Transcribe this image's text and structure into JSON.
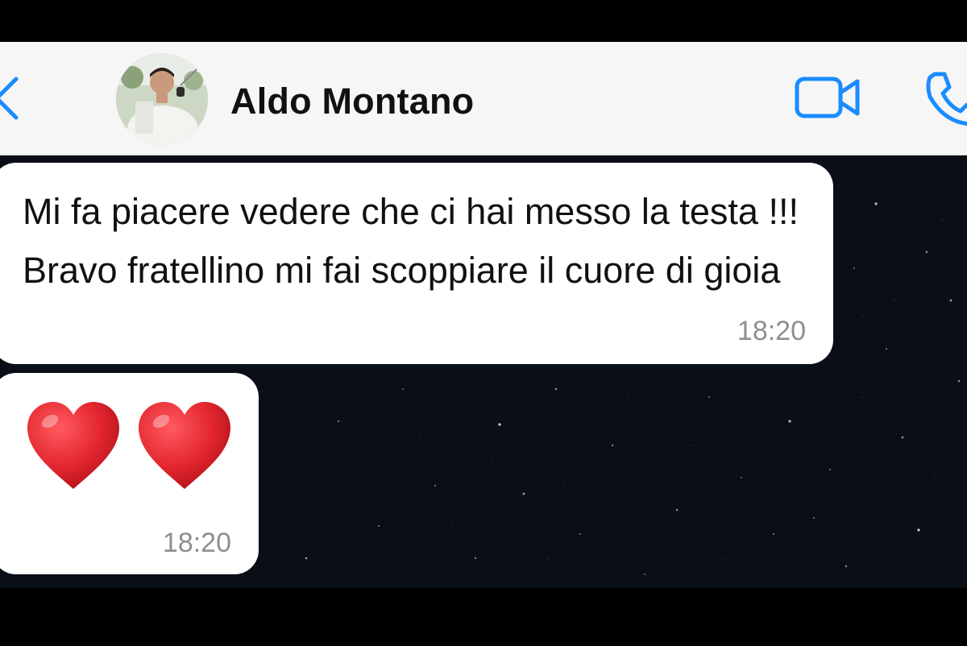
{
  "header": {
    "contact_name": "Aldo Montano",
    "back_icon": "chevron-left-icon",
    "video_icon": "video-camera-icon",
    "phone_icon": "phone-icon",
    "accent_color": "#1a8cff"
  },
  "messages": [
    {
      "text": "Mi fa piacere vedere che ci hai messo la testa !!! Bravo fratellino mi fai scoppiare il cuore di gioia",
      "time": "18:20"
    },
    {
      "content": "❤️❤️",
      "time": "18:20"
    }
  ],
  "colors": {
    "header_bg": "#f6f6f6",
    "chat_bg": "#0a0e16",
    "bubble_bg": "#ffffff",
    "heart": "#e3262f"
  }
}
